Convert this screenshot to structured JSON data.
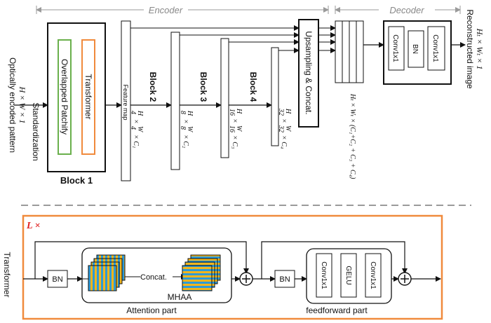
{
  "encoder": {
    "label": "Encoder",
    "input_label_1": "Optically encoded pattern",
    "input_label_2": "H × W × 1",
    "standardization": "Standardization",
    "block1": {
      "title": "Block 1",
      "patchify": "Overlapped Patchify",
      "transformer": "Transformer"
    },
    "feature_map": "Feature map",
    "stages": [
      {
        "name": "Block 2",
        "dim_h": "H",
        "dim_h_div": "4",
        "dim_w": "W",
        "dim_w_div": "4",
        "channels": "× C₁"
      },
      {
        "name": "Block 3",
        "dim_h": "H",
        "dim_h_div": "8",
        "dim_w": "W",
        "dim_w_div": "8",
        "channels": "× C₂"
      },
      {
        "name": "Block 4",
        "dim_h": "H",
        "dim_h_div": "16",
        "dim_w": "W",
        "dim_w_div": "16",
        "channels": "× C₃"
      },
      {
        "name": "",
        "dim_h": "H",
        "dim_h_div": "32",
        "dim_w": "W",
        "dim_w_div": "32",
        "channels": "× C₄"
      }
    ],
    "upsampling": "Upsampling & Concat.",
    "concat_dims": "Hₜ × Wₜ × (C₁+C₂ + C₃ + C₄)"
  },
  "decoder": {
    "label": "Decoder",
    "layers": [
      "Conv1x1",
      "BN",
      "Conv1x1"
    ],
    "output_label_1": "Reconstructed image",
    "output_label_2": "Hₜ × Wₜ × 1"
  },
  "transformer_detail": {
    "side_label": "Transformer",
    "repeat": "L ×",
    "bn1": "BN",
    "concat": "Concat.",
    "mhaa": "MHAA",
    "attention_part": "Attention part",
    "bn2": "BN",
    "ff_layers": [
      "Conv1x1",
      "GELU",
      "Conv1x1"
    ],
    "feedforward_part": "feedforward part",
    "plus": "+"
  },
  "colors": {
    "patchify_border": "#6ab04c",
    "transformer_border": "#f08a3c",
    "detail_border": "#f08a3c",
    "stripe_blue": "#2e9bd6",
    "stripe_yellow": "#f2b51c",
    "repeat_red": "#e02020",
    "dash_gray": "#9a9a9a"
  }
}
